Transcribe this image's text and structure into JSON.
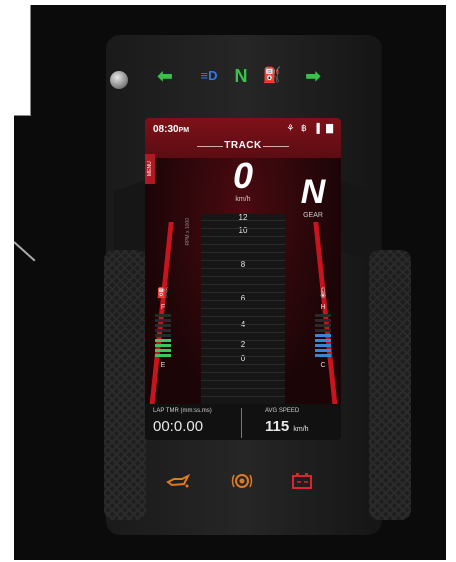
{
  "telltales": [
    {
      "name": "left-turn-indicator-icon",
      "glyph": "⬅",
      "color": "#39c24a"
    },
    {
      "name": "headlight-indicator-icon",
      "glyph": "≡D",
      "color": "#2f78e6"
    },
    {
      "name": "neutral-indicator",
      "glyph": "N",
      "color": "#38c44a"
    },
    {
      "name": "fuel-warning-icon",
      "glyph": "⛽",
      "color": "#f09a22"
    },
    {
      "name": "right-turn-indicator-icon",
      "glyph": "➡",
      "color": "#39c24a"
    }
  ],
  "status_bar": {
    "time": "08:30",
    "time_suffix": "PM",
    "icons": "⚘ ฿ ▐ ▇"
  },
  "mode_label": "TRACK",
  "menu_tab": "MENU",
  "speed": {
    "value": "0",
    "unit": "km/h"
  },
  "gear": {
    "value": "N",
    "label": "GEAR"
  },
  "rpm_label": "RPM x 1000",
  "tach_numbers": [
    "12",
    "10",
    "8",
    "6",
    "4",
    "2",
    "0"
  ],
  "fuel_gauge": {
    "full_label": "F",
    "empty_label": "E",
    "level_bars": 4,
    "total_bars": 9,
    "color": "#3ac75b"
  },
  "temp_gauge": {
    "high_label": "H",
    "low_label": "C",
    "level_bars": 5,
    "total_bars": 9,
    "color": "#3a86d4"
  },
  "lap_timer": {
    "label": "LAP TMR (mm:ss.ms)",
    "value": "00:0.00"
  },
  "avg_speed": {
    "label": "AVG SPEED",
    "value": "115",
    "unit": "km/h"
  },
  "warning_lights": [
    {
      "name": "oil-pressure-warning-icon",
      "color": "#e07a1e"
    },
    {
      "name": "abs-warning-icon",
      "color": "#e07a1e"
    },
    {
      "name": "battery-warning-icon",
      "color": "#d8262e"
    }
  ],
  "colors": {
    "accent_red": "#c8141e",
    "screen_red": "#7e1018"
  }
}
